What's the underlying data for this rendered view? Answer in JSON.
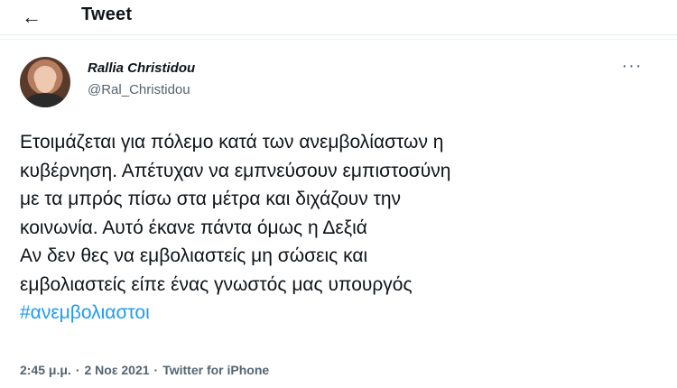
{
  "header": {
    "back_icon": "arrow-left-icon",
    "back_glyph": "←",
    "title": "Tweet"
  },
  "author": {
    "name": "Rallia Christidou",
    "handle": "@Ral_Christidou",
    "more_glyph": "···"
  },
  "tweet": {
    "lines": [
      "Ετοιμάζεται για πόλεμο κατά των ανεμβολίαστων η",
      "κυβέρνηση. Απέτυχαν να εμπνεύσουν εμπιστοσύνη",
      "με τα μπρός πίσω στα μέτρα και διχάζουν την",
      "κοινωνία. Αυτό έκανε πάντα όμως η Δεξιά",
      "Αν δεν θες να εμβολιαστείς μη σώσεις και",
      "εμβολιαστείς είπε ένας γνωστός μας υπουργός"
    ],
    "hashtag": "#ανεμβολιαστοι"
  },
  "meta": {
    "time": "2:45 μ.μ.",
    "separator": "·",
    "date": "2 Νοε 2021",
    "source": "Twitter for iPhone"
  },
  "colors": {
    "link": "#1d9bf0",
    "secondary_text": "#536471",
    "primary_text": "#0f1419"
  }
}
